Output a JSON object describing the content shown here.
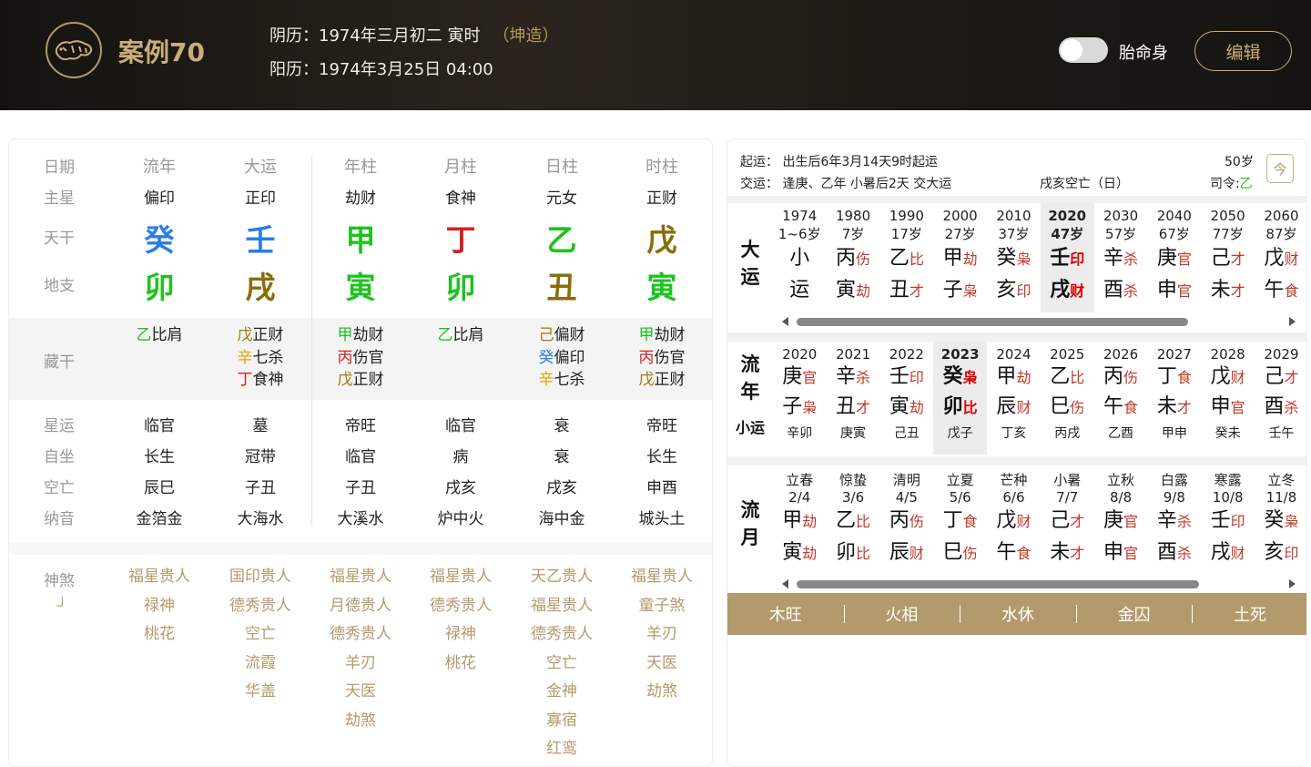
{
  "header": {
    "title": "案例70",
    "lunar": "阴历：1974年三月初二 寅时",
    "gender": "（坤造）",
    "solar": "阳历：1974年3月25日 04:00",
    "toggle_label": "胎命身",
    "toggle_on": false,
    "edit_label": "编辑"
  },
  "chart": {
    "row_labels": {
      "date": "日期",
      "main_star": "主星",
      "stem": "天干",
      "branch": "地支",
      "hidden": "藏干",
      "xingyun": "星运",
      "zizuo": "自坐",
      "kongwang": "空亡",
      "nayin": "纳音",
      "shensha": "神煞",
      "shensha_sub": "㇘"
    },
    "columns": [
      {
        "header": "流年",
        "main_star": "偏印",
        "stem": "癸",
        "stem_color": "#2b7de9",
        "branch": "卯",
        "branch_color": "#1fc21f",
        "hidden": [
          {
            "g": "乙",
            "gc": "#1fc21f",
            "s": "比肩"
          }
        ],
        "xingyun": "临官",
        "zizuo": "长生",
        "kongwang": "辰巳",
        "nayin": "金箔金",
        "shensha": [
          "福星贵人",
          "禄神",
          "桃花"
        ]
      },
      {
        "header": "大运",
        "main_star": "正印",
        "stem": "壬",
        "stem_color": "#2b7de9",
        "branch": "戌",
        "branch_color": "#8a6d0b",
        "hidden": [
          {
            "g": "戊",
            "gc": "#a07a10",
            "s": "正财"
          },
          {
            "g": "辛",
            "gc": "#e6a100",
            "s": "七杀"
          },
          {
            "g": "丁",
            "gc": "#d92020",
            "s": "食神"
          }
        ],
        "xingyun": "墓",
        "zizuo": "冠带",
        "kongwang": "子丑",
        "nayin": "大海水",
        "shensha": [
          "国印贵人",
          "德秀贵人",
          "空亡",
          "流霞",
          "华盖"
        ]
      },
      {
        "header": "年柱",
        "main_star": "劫财",
        "stem": "甲",
        "stem_color": "#1fc21f",
        "branch": "寅",
        "branch_color": "#1fc21f",
        "hidden": [
          {
            "g": "甲",
            "gc": "#1fc21f",
            "s": "劫财"
          },
          {
            "g": "丙",
            "gc": "#d92020",
            "s": "伤官"
          },
          {
            "g": "戊",
            "gc": "#a07a10",
            "s": "正财"
          }
        ],
        "xingyun": "帝旺",
        "zizuo": "临官",
        "kongwang": "子丑",
        "nayin": "大溪水",
        "shensha": [
          "福星贵人",
          "月德贵人",
          "德秀贵人",
          "羊刃",
          "天医",
          "劫煞"
        ]
      },
      {
        "header": "月柱",
        "main_star": "食神",
        "stem": "丁",
        "stem_color": "#d92020",
        "branch": "卯",
        "branch_color": "#1fc21f",
        "hidden": [
          {
            "g": "乙",
            "gc": "#1fc21f",
            "s": "比肩"
          }
        ],
        "xingyun": "临官",
        "zizuo": "病",
        "kongwang": "戌亥",
        "nayin": "炉中火",
        "shensha": [
          "福星贵人",
          "德秀贵人",
          "禄神",
          "桃花"
        ]
      },
      {
        "header": "日柱",
        "main_star": "元女",
        "stem": "乙",
        "stem_color": "#1fc21f",
        "branch": "丑",
        "branch_color": "#8a6d0b",
        "hidden": [
          {
            "g": "己",
            "gc": "#a07a10",
            "s": "偏财"
          },
          {
            "g": "癸",
            "gc": "#2b7de9",
            "s": "偏印"
          },
          {
            "g": "辛",
            "gc": "#e6a100",
            "s": "七杀"
          }
        ],
        "xingyun": "衰",
        "zizuo": "衰",
        "kongwang": "戌亥",
        "nayin": "海中金",
        "shensha": [
          "天乙贵人",
          "福星贵人",
          "德秀贵人",
          "空亡",
          "金神",
          "寡宿",
          "红鸾"
        ]
      },
      {
        "header": "时柱",
        "main_star": "正财",
        "stem": "戊",
        "stem_color": "#8a6d0b",
        "branch": "寅",
        "branch_color": "#1fc21f",
        "hidden": [
          {
            "g": "甲",
            "gc": "#1fc21f",
            "s": "劫财"
          },
          {
            "g": "丙",
            "gc": "#d92020",
            "s": "伤官"
          },
          {
            "g": "戊",
            "gc": "#a07a10",
            "s": "正财"
          }
        ],
        "xingyun": "帝旺",
        "zizuo": "长生",
        "kongwang": "申酉",
        "nayin": "城头土",
        "shensha": [
          "福星贵人",
          "童子煞",
          "羊刃",
          "天医",
          "劫煞"
        ]
      }
    ]
  },
  "right": {
    "qiyun": "起运：  出生后6年3月14天9时起运",
    "jiaoyun": "交运：  逢庚、乙年 小暑后2天 交大运",
    "age": "50岁",
    "kongwang": "戌亥空亡（日）",
    "siling_label": "司令:",
    "siling": "乙",
    "siling_color": "#1fc21f",
    "cal_icon": "今",
    "dayun_label": [
      "大",
      "运"
    ],
    "dayun": [
      {
        "y": "1974",
        "a": "1~6岁",
        "s1": "小",
        "t1": "",
        "s2": "运",
        "t2": ""
      },
      {
        "y": "1980",
        "a": "7岁",
        "s1": "丙",
        "t1": "伤",
        "s2": "寅",
        "t2": "劫"
      },
      {
        "y": "1990",
        "a": "17岁",
        "s1": "乙",
        "t1": "比",
        "s2": "丑",
        "t2": "才"
      },
      {
        "y": "2000",
        "a": "27岁",
        "s1": "甲",
        "t1": "劫",
        "s2": "子",
        "t2": "枭"
      },
      {
        "y": "2010",
        "a": "37岁",
        "s1": "癸",
        "t1": "枭",
        "s2": "亥",
        "t2": "印"
      },
      {
        "y": "2020",
        "a": "47岁",
        "s1": "壬",
        "t1": "印",
        "s2": "戌",
        "t2": "财",
        "sel": true
      },
      {
        "y": "2030",
        "a": "57岁",
        "s1": "辛",
        "t1": "杀",
        "s2": "酉",
        "t2": "杀"
      },
      {
        "y": "2040",
        "a": "67岁",
        "s1": "庚",
        "t1": "官",
        "s2": "申",
        "t2": "官"
      },
      {
        "y": "2050",
        "a": "77岁",
        "s1": "己",
        "t1": "才",
        "s2": "未",
        "t2": "才"
      },
      {
        "y": "2060",
        "a": "87岁",
        "s1": "戊",
        "t1": "财",
        "s2": "午",
        "t2": "食"
      }
    ],
    "liunian_label": [
      "流",
      "年"
    ],
    "xiaoyun_label": "小运",
    "liunian": [
      {
        "y": "2020",
        "s1": "庚",
        "t1": "官",
        "s2": "子",
        "t2": "枭",
        "sub": "辛卯"
      },
      {
        "y": "2021",
        "s1": "辛",
        "t1": "杀",
        "s2": "丑",
        "t2": "才",
        "sub": "庚寅"
      },
      {
        "y": "2022",
        "s1": "壬",
        "t1": "印",
        "s2": "寅",
        "t2": "劫",
        "sub": "己丑"
      },
      {
        "y": "2023",
        "s1": "癸",
        "t1": "枭",
        "s2": "卯",
        "t2": "比",
        "sub": "戊子",
        "sel": true
      },
      {
        "y": "2024",
        "s1": "甲",
        "t1": "劫",
        "s2": "辰",
        "t2": "财",
        "sub": "丁亥"
      },
      {
        "y": "2025",
        "s1": "乙",
        "t1": "比",
        "s2": "巳",
        "t2": "伤",
        "sub": "丙戌"
      },
      {
        "y": "2026",
        "s1": "丙",
        "t1": "伤",
        "s2": "午",
        "t2": "食",
        "sub": "乙酉"
      },
      {
        "y": "2027",
        "s1": "丁",
        "t1": "食",
        "s2": "未",
        "t2": "才",
        "sub": "甲申"
      },
      {
        "y": "2028",
        "s1": "戊",
        "t1": "财",
        "s2": "申",
        "t2": "官",
        "sub": "癸未"
      },
      {
        "y": "2029",
        "s1": "己",
        "t1": "才",
        "s2": "酉",
        "t2": "杀",
        "sub": "壬午"
      }
    ],
    "liuyue_label": [
      "流",
      "月"
    ],
    "liuyue": [
      {
        "n": "立春",
        "d": "2/4",
        "s1": "甲",
        "t1": "劫",
        "s2": "寅",
        "t2": "劫"
      },
      {
        "n": "惊蛰",
        "d": "3/6",
        "s1": "乙",
        "t1": "比",
        "s2": "卯",
        "t2": "比"
      },
      {
        "n": "清明",
        "d": "4/5",
        "s1": "丙",
        "t1": "伤",
        "s2": "辰",
        "t2": "财"
      },
      {
        "n": "立夏",
        "d": "5/6",
        "s1": "丁",
        "t1": "食",
        "s2": "巳",
        "t2": "伤"
      },
      {
        "n": "芒种",
        "d": "6/6",
        "s1": "戊",
        "t1": "财",
        "s2": "午",
        "t2": "食"
      },
      {
        "n": "小暑",
        "d": "7/7",
        "s1": "己",
        "t1": "才",
        "s2": "未",
        "t2": "才"
      },
      {
        "n": "立秋",
        "d": "8/8",
        "s1": "庚",
        "t1": "官",
        "s2": "申",
        "t2": "官"
      },
      {
        "n": "白露",
        "d": "9/8",
        "s1": "辛",
        "t1": "杀",
        "s2": "酉",
        "t2": "杀"
      },
      {
        "n": "寒露",
        "d": "10/8",
        "s1": "壬",
        "t1": "印",
        "s2": "戌",
        "t2": "财"
      },
      {
        "n": "立冬",
        "d": "11/8",
        "s1": "癸",
        "t1": "枭",
        "s2": "亥",
        "t2": "印"
      }
    ],
    "wuxing": [
      "木旺",
      "火相",
      "水休",
      "金囚",
      "土死"
    ]
  }
}
